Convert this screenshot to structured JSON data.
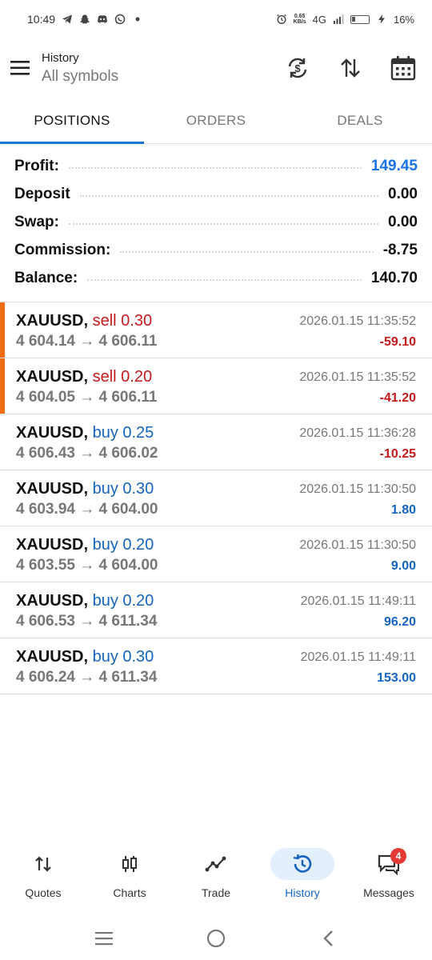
{
  "status_bar": {
    "time": "10:49",
    "net_speed_top": "0.65",
    "net_speed_bottom": "KB/s",
    "network": "4G",
    "battery": "16%"
  },
  "header": {
    "title": "History",
    "subtitle": "All symbols"
  },
  "tabs": [
    {
      "label": "POSITIONS",
      "active": true
    },
    {
      "label": "ORDERS",
      "active": false
    },
    {
      "label": "DEALS",
      "active": false
    }
  ],
  "summary": [
    {
      "label": "Profit:",
      "value": "149.45"
    },
    {
      "label": "Deposit",
      "value": "0.00"
    },
    {
      "label": "Swap:",
      "value": "0.00"
    },
    {
      "label": "Commission:",
      "value": "-8.75"
    },
    {
      "label": "Balance:",
      "value": "140.70"
    }
  ],
  "deals": [
    {
      "symbol": "XAUUSD,",
      "type": "sell 0.30",
      "prices": "4 604.14 → 4 606.11",
      "time": "2026.01.15 11:35:52",
      "profit": "-59.10"
    },
    {
      "symbol": "XAUUSD,",
      "type": "sell 0.20",
      "prices": "4 604.05 → 4 606.11",
      "time": "2026.01.15 11:35:52",
      "profit": "-41.20"
    },
    {
      "symbol": "XAUUSD,",
      "type": "buy 0.25",
      "prices": "4 606.43 → 4 606.02",
      "time": "2026.01.15 11:36:28",
      "profit": "-10.25"
    },
    {
      "symbol": "XAUUSD,",
      "type": "buy 0.30",
      "prices": "4 603.94 → 4 604.00",
      "time": "2026.01.15 11:30:50",
      "profit": "1.80"
    },
    {
      "symbol": "XAUUSD,",
      "type": "buy 0.20",
      "prices": "4 603.55 → 4 604.00",
      "time": "2026.01.15 11:30:50",
      "profit": "9.00"
    },
    {
      "symbol": "XAUUSD,",
      "type": "buy 0.20",
      "prices": "4 606.53 → 4 611.34",
      "time": "2026.01.15 11:49:11",
      "profit": "96.20"
    },
    {
      "symbol": "XAUUSD,",
      "type": "buy 0.30",
      "prices": "4 606.24 → 4 611.34",
      "time": "2026.01.15 11:49:11",
      "profit": "153.00"
    }
  ],
  "bottom_nav": [
    {
      "label": "Quotes",
      "icon": "quotes-icon"
    },
    {
      "label": "Charts",
      "icon": "charts-icon"
    },
    {
      "label": "Trade",
      "icon": "trade-icon"
    },
    {
      "label": "History",
      "icon": "history-icon",
      "active": true
    },
    {
      "label": "Messages",
      "icon": "messages-icon",
      "badge": "4"
    }
  ],
  "colors": {
    "accent": "#1976d2",
    "sell": "#c41a1a",
    "buy": "#1565c0",
    "position_marker": "#ef6c16"
  }
}
